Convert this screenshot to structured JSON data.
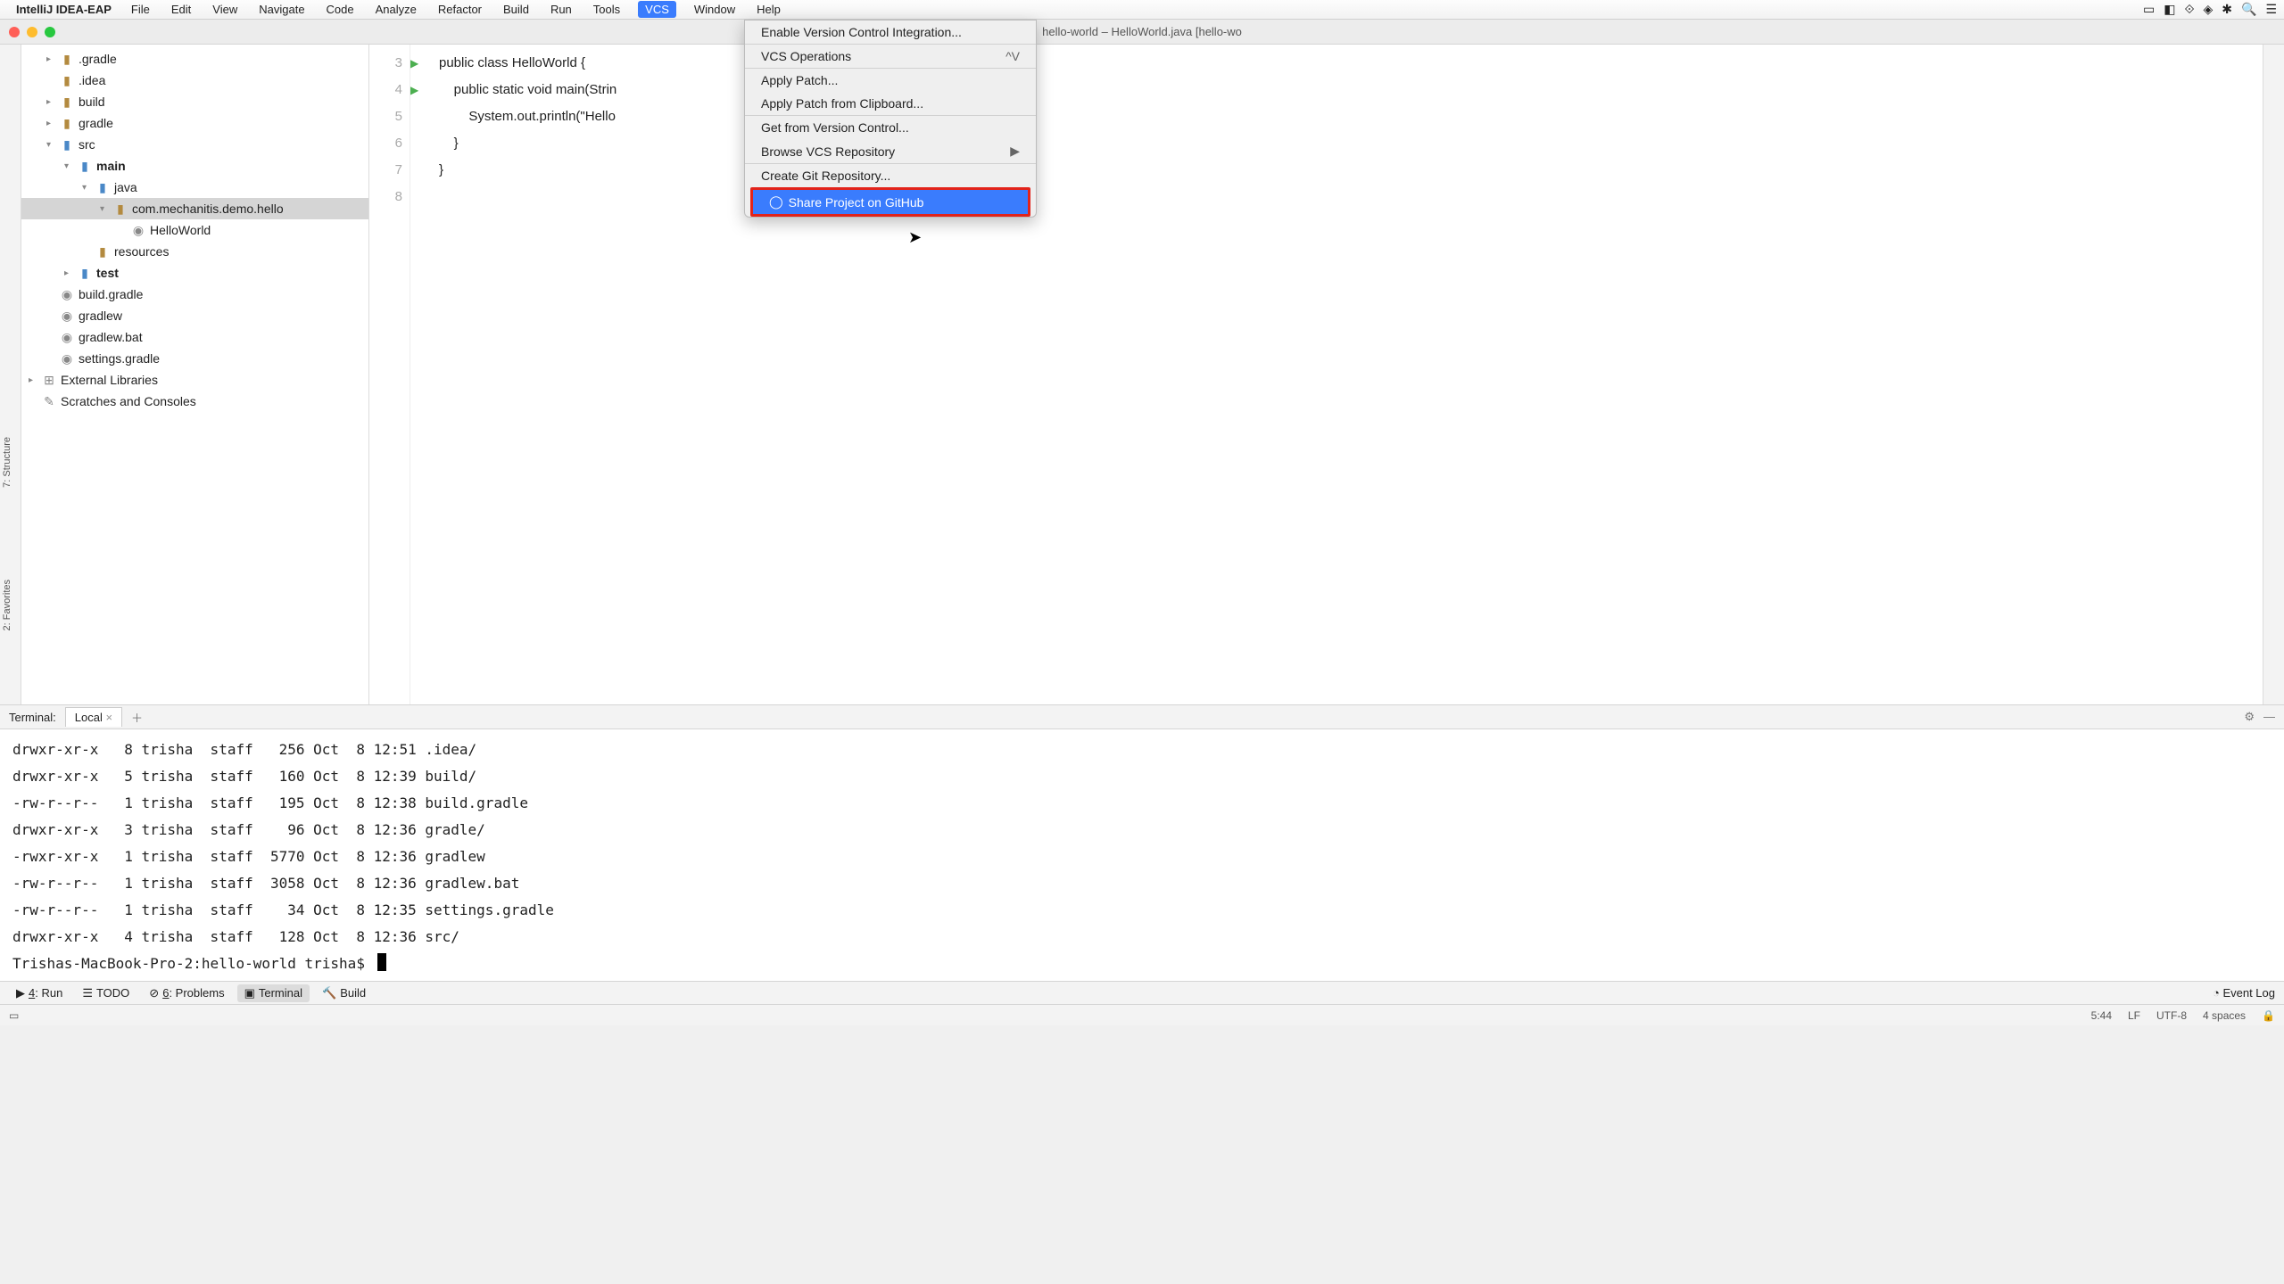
{
  "menubar": {
    "app": "IntelliJ IDEA-EAP",
    "items": [
      "File",
      "Edit",
      "View",
      "Navigate",
      "Code",
      "Analyze",
      "Refactor",
      "Build",
      "Run",
      "Tools",
      "VCS",
      "Window",
      "Help"
    ],
    "active": "VCS"
  },
  "window": {
    "title": "hello-world – HelloWorld.java [hello-wo"
  },
  "tree": {
    "items": [
      {
        "indent": 1,
        "arrow": "▸",
        "icon": "folder",
        "label": ".gradle"
      },
      {
        "indent": 1,
        "arrow": "",
        "icon": "folder",
        "label": ".idea"
      },
      {
        "indent": 1,
        "arrow": "▸",
        "icon": "folder",
        "label": "build"
      },
      {
        "indent": 1,
        "arrow": "▸",
        "icon": "folder",
        "label": "gradle"
      },
      {
        "indent": 1,
        "arrow": "▾",
        "icon": "folder-blue",
        "label": "src",
        "bold": false
      },
      {
        "indent": 2,
        "arrow": "▾",
        "icon": "folder-blue",
        "label": "main",
        "bold": true
      },
      {
        "indent": 3,
        "arrow": "▾",
        "icon": "folder-blue",
        "label": "java",
        "bold": false
      },
      {
        "indent": 4,
        "arrow": "▾",
        "icon": "folder",
        "label": "com.mechanitis.demo.hello",
        "sel": true
      },
      {
        "indent": 5,
        "arrow": "",
        "icon": "file",
        "label": "HelloWorld"
      },
      {
        "indent": 3,
        "arrow": "",
        "icon": "folder",
        "label": "resources"
      },
      {
        "indent": 2,
        "arrow": "▸",
        "icon": "folder-blue",
        "label": "test",
        "bold": true
      },
      {
        "indent": 1,
        "arrow": "",
        "icon": "file",
        "label": "build.gradle"
      },
      {
        "indent": 1,
        "arrow": "",
        "icon": "file",
        "label": "gradlew"
      },
      {
        "indent": 1,
        "arrow": "",
        "icon": "file",
        "label": "gradlew.bat"
      },
      {
        "indent": 1,
        "arrow": "",
        "icon": "file",
        "label": "settings.gradle"
      },
      {
        "indent": 0,
        "arrow": "▸",
        "icon": "lib",
        "label": "External Libraries"
      },
      {
        "indent": 0,
        "arrow": "",
        "icon": "scratch",
        "label": "Scratches and Consoles"
      }
    ]
  },
  "editor": {
    "lines": [
      {
        "n": 3,
        "run": true,
        "html": "<span class='kw'>public class</span> <span class='cls'>HelloWorld</span> {"
      },
      {
        "n": 4,
        "run": true,
        "html": "    <span class='kw'>public static void</span> <span class='cls'>main</span>(Strin"
      },
      {
        "n": 5,
        "run": false,
        "html": "        System.<span class='fld'>out</span>.println(<span class='str'>\"Hello"
      },
      {
        "n": 6,
        "run": false,
        "html": "    }"
      },
      {
        "n": 7,
        "run": false,
        "html": "}"
      },
      {
        "n": 8,
        "run": false,
        "html": ""
      }
    ]
  },
  "vcsmenu": {
    "items": [
      {
        "label": "Enable Version Control Integration..."
      },
      {
        "label": "VCS Operations",
        "shortcut": "^V",
        "sep": true
      },
      {
        "label": "Apply Patch...",
        "sep": true
      },
      {
        "label": "Apply Patch from Clipboard..."
      },
      {
        "label": "Get from Version Control...",
        "sep": true
      },
      {
        "label": "Browse VCS Repository",
        "submenu": true
      },
      {
        "label": "Create Git Repository...",
        "sep": true
      },
      {
        "label": "Share Project on GitHub",
        "highlight": true,
        "icon": "github"
      }
    ]
  },
  "terminal": {
    "title": "Terminal:",
    "tab": "Local",
    "lines": [
      "drwxr-xr-x   8 trisha  staff   256 Oct  8 12:51 .idea/",
      "drwxr-xr-x   5 trisha  staff   160 Oct  8 12:39 build/",
      "-rw-r--r--   1 trisha  staff   195 Oct  8 12:38 build.gradle",
      "drwxr-xr-x   3 trisha  staff    96 Oct  8 12:36 gradle/",
      "-rwxr-xr-x   1 trisha  staff  5770 Oct  8 12:36 gradlew",
      "-rw-r--r--   1 trisha  staff  3058 Oct  8 12:36 gradlew.bat",
      "-rw-r--r--   1 trisha  staff    34 Oct  8 12:35 settings.gradle",
      "drwxr-xr-x   4 trisha  staff   128 Oct  8 12:36 src/"
    ],
    "prompt": "Trishas-MacBook-Pro-2:hello-world trisha$ "
  },
  "toolrow": {
    "buttons": [
      {
        "icon": "▶",
        "label": "4: Run",
        "u": "4"
      },
      {
        "icon": "☰",
        "label": "TODO"
      },
      {
        "icon": "⊘",
        "label": "6: Problems",
        "u": "6"
      },
      {
        "icon": "▣",
        "label": "Terminal",
        "active": true
      },
      {
        "icon": "🔨",
        "label": "Build"
      }
    ],
    "eventlog": "Event Log"
  },
  "status": {
    "right": [
      "5:44",
      "LF",
      "UTF-8",
      "4 spaces",
      "🔒"
    ]
  },
  "sidebar_left": [
    "7: Structure",
    "2: Favorites"
  ]
}
